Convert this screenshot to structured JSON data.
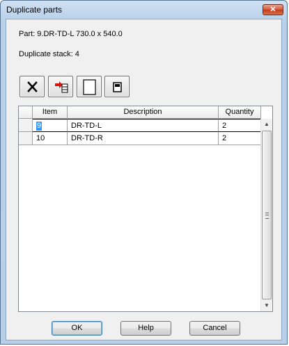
{
  "window": {
    "title": "Duplicate parts",
    "close_glyph": "✕"
  },
  "info": {
    "part": "Part: 9.DR-TD-L 730.0 x 540.0",
    "duplicate_stack": "Duplicate stack: 4"
  },
  "toolbar": {
    "icons": [
      "delete-icon",
      "insert-row-icon",
      "blank-page-icon",
      "book-icon"
    ]
  },
  "grid": {
    "columns": [
      "Item",
      "Description",
      "Quantity"
    ],
    "rows": [
      {
        "item": "9",
        "description": "DR-TD-L",
        "quantity": "2"
      },
      {
        "item": "10",
        "description": "DR-TD-R",
        "quantity": "2"
      }
    ],
    "scroll_up": "▲",
    "scroll_down": "▼"
  },
  "buttons": {
    "ok": "OK",
    "help": "Help",
    "cancel": "Cancel"
  }
}
